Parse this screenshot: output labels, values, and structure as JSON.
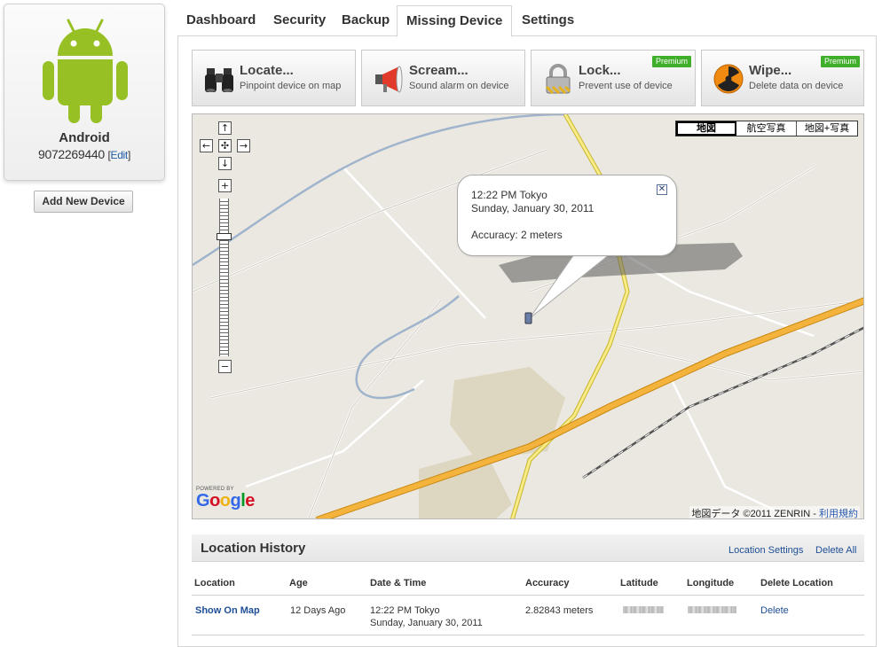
{
  "device": {
    "name": "Android",
    "number": "9072269440",
    "edit_label": "Edit",
    "add_button": "Add New Device",
    "logo_color": "#97c024"
  },
  "tabs": [
    {
      "label": "Dashboard",
      "active": false
    },
    {
      "label": "Security",
      "active": false
    },
    {
      "label": "Backup",
      "active": false
    },
    {
      "label": "Missing Device",
      "active": true
    },
    {
      "label": "Settings",
      "active": false
    }
  ],
  "actions": [
    {
      "title": "Locate...",
      "subtitle": "Pinpoint device on map",
      "icon": "binoculars-icon",
      "premium": ""
    },
    {
      "title": "Scream...",
      "subtitle": "Sound alarm on device",
      "icon": "megaphone-icon",
      "premium": ""
    },
    {
      "title": "Lock...",
      "subtitle": "Prevent use of device",
      "icon": "padlock-icon",
      "premium": "Premium"
    },
    {
      "title": "Wipe...",
      "subtitle": "Delete data on device",
      "icon": "radiation-icon",
      "premium": "Premium"
    }
  ],
  "map": {
    "types": [
      "地図",
      "航空写真",
      "地図+写真"
    ],
    "selected_type": "地図",
    "info": {
      "time": "12:22 PM Tokyo",
      "date": "Sunday, January 30, 2011",
      "accuracy": "Accuracy: 2 meters"
    },
    "powered_by": "POWERED BY",
    "brand": "Google",
    "copyright": "地図データ ©2011 ZENRIN - ",
    "terms_link": "利用規約",
    "zoom_level_fraction": 0.22
  },
  "history": {
    "title": "Location History",
    "settings_link": "Location Settings",
    "delete_all_link": "Delete All",
    "columns": [
      "Location",
      "Age",
      "Date & Time",
      "Accuracy",
      "Latitude",
      "Longitude",
      "Delete Location"
    ],
    "rows": [
      {
        "location": "Show On Map",
        "age": "12 Days Ago",
        "time": "12:22 PM Tokyo",
        "date": "Sunday, January 30, 2011",
        "accuracy": "2.82843 meters",
        "delete": "Delete"
      }
    ]
  }
}
